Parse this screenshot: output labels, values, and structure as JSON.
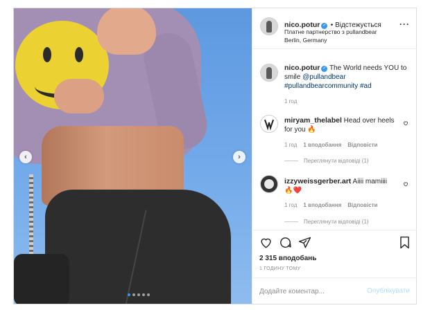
{
  "post": {
    "author": {
      "username": "nico.potur",
      "follow_label": "Відстежується",
      "partnership": "Платне партнерство з pullandbear",
      "location": "Berlin, Germany",
      "more_icon": "more-horizontal-icon"
    },
    "caption": {
      "username": "nico.potur",
      "text_plain": "The World needs YOU to smile",
      "mention": "@pullandbear",
      "hashtags": "#pullandbearcommunity #ad",
      "time": "1 год"
    },
    "comments": [
      {
        "username": "miryam_thelabel",
        "text": "Head over heels for you 🔥",
        "time": "1 год",
        "likes": "1 вподобання",
        "reply_label": "Відповісти",
        "view_replies": "Переглянути відповіді (1)"
      },
      {
        "username": "izzyweissgerber.art",
        "text": "Aiiii mamiiii🔥❤️",
        "time": "1 год",
        "likes": "1 вподобання",
        "reply_label": "Відповісти",
        "view_replies": "Переглянути відповіді (1)"
      }
    ],
    "likes_count": "2 315 вподобань",
    "time_ago": "1 ГОДИНУ ТОМУ",
    "comment_placeholder": "Додайте коментар...",
    "publish_label": "Опублікувати",
    "carousel": {
      "slides": 5,
      "active_index": 0
    },
    "colors": {
      "accent": "#3897f0",
      "text": "#262626",
      "muted": "#8e8e8e",
      "publish_disabled": "#b2dffc",
      "border": "#dbdbdb"
    },
    "icons": [
      "heart-icon",
      "comment-icon",
      "share-icon",
      "bookmark-icon",
      "verified-icon",
      "chevron-left-icon",
      "chevron-right-icon"
    ]
  }
}
